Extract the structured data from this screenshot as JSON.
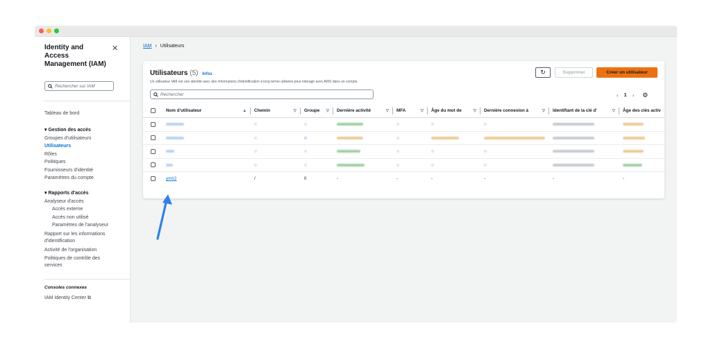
{
  "sidebar": {
    "title": "Identity and Access Management (IAM)",
    "search_placeholder": "Rechercher sur IAM",
    "dashboard": "Tableau de bord",
    "access_management": {
      "title": "Gestion des accès",
      "items": [
        "Groupes d'utilisateurs",
        "Utilisateurs",
        "Rôles",
        "Politiques",
        "Fournisseurs d'identité",
        "Paramètres du compte"
      ]
    },
    "access_reports": {
      "title": "Rapports d'accès",
      "analyzer": "Analyseur d'accès",
      "analyzer_items": [
        "Accès externe",
        "Accès non utilisé",
        "Paramètres de l'analyseur"
      ],
      "credential_report": "Rapport sur les informations d'identification",
      "org_activity": "Activité de l'organisation",
      "scp": "Politiques de contrôle des services"
    },
    "related_consoles": "Consoles connexes",
    "identity_center": "IAM Identity Center"
  },
  "breadcrumb": {
    "root": "IAM",
    "current": "Utilisateurs"
  },
  "panel": {
    "title": "Utilisateurs",
    "count": "(5)",
    "info": "Infos",
    "description": "Un utilisateur IAM est une identité avec des informations d'identification à long terme utilisées pour interagir avec AWS dans un compte.",
    "delete_label": "Supprimer",
    "create_label": "Créer un utilisateur",
    "search_placeholder": "Rechercher",
    "page": "1"
  },
  "table": {
    "columns": [
      "Nom d'utilisateur",
      "Chemin",
      "Groupe",
      "Dernière activité",
      "MFA",
      "Âge du mot de",
      "Dernière connexion à",
      "Identifiant de la clé d'",
      "Âge des clés activ"
    ],
    "last_row": {
      "user": "ymir2",
      "path": "/",
      "groups": "0",
      "activity": "-",
      "mfa": "-",
      "password_age": "-",
      "last_login": "-",
      "key_id": "-",
      "key_age": "-"
    }
  },
  "colors": {
    "accent": "#0972d3",
    "primary_button": "#ec7211",
    "arrow": "#2f80ed"
  }
}
